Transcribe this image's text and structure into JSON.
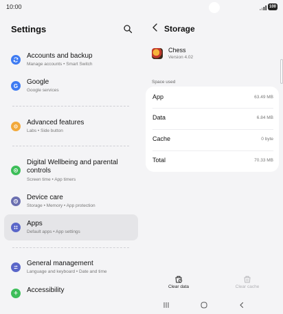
{
  "status": {
    "time": "10:00",
    "battery": "100"
  },
  "settings": {
    "title": "Settings",
    "items": [
      {
        "title": "Accounts and backup",
        "sub": "Manage accounts  •  Smart Switch",
        "icon_color": "#3e7bf2",
        "icon": "sync-icon"
      },
      {
        "title": "Google",
        "sub": "Google services",
        "icon_color": "#3e7bf2",
        "icon": "google-icon"
      },
      {
        "title": "Advanced features",
        "sub": "Labs  •  Side button",
        "icon_color": "#f2a93b",
        "icon": "gear-plus-icon"
      },
      {
        "title": "Digital Wellbeing and parental controls",
        "sub": "Screen time  •  App timers",
        "icon_color": "#3dbe59",
        "icon": "wellbeing-icon"
      },
      {
        "title": "Device care",
        "sub": "Storage  •  Memory  •  App protection",
        "icon_color": "#6b6fb0",
        "icon": "device-care-icon"
      },
      {
        "title": "Apps",
        "sub": "Default apps  •  App settings",
        "icon_color": "#5a66c9",
        "icon": "apps-icon"
      },
      {
        "title": "General management",
        "sub": "Language and keyboard  •  Date and time",
        "icon_color": "#5a66c9",
        "icon": "sliders-icon"
      },
      {
        "title": "Accessibility",
        "sub": "",
        "icon_color": "#3dbe59",
        "icon": "accessibility-icon"
      }
    ]
  },
  "storage": {
    "title": "Storage",
    "app_name": "Chess",
    "app_version": "Version 4.02",
    "section_label": "Space used",
    "rows": [
      {
        "label": "App",
        "value": "63.49 MB"
      },
      {
        "label": "Data",
        "value": "6.84 MB"
      },
      {
        "label": "Cache",
        "value": "0 byte"
      },
      {
        "label": "Total",
        "value": "70.33 MB"
      }
    ],
    "clear_data": "Clear data",
    "clear_cache": "Clear cache"
  }
}
